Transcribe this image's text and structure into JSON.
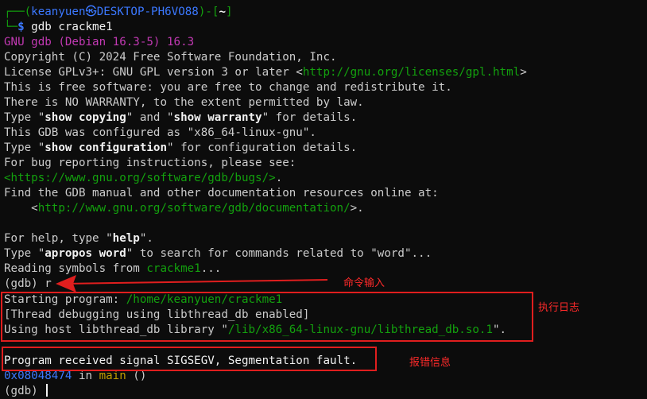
{
  "prompt": {
    "open": "┌──(",
    "user": "keanyuen",
    "at": "㉿",
    "host": "DESKTOP-PH6VO88",
    "mid": ")-[",
    "path": "~",
    "close": "]",
    "corner": "└─",
    "dollar": "$",
    "command": " gdb crackme1"
  },
  "gdb_banner": "GNU gdb (Debian 16.3-5) 16.3",
  "lines": {
    "copyright": "Copyright (C) 2024 Free Software Foundation, Inc.",
    "license_pre": "License GPLv3+: GNU GPL version 3 or later <",
    "license_url": "http://gnu.org/licenses/gpl.html",
    "license_post": ">",
    "free": "This is free software: you are free to change and redistribute it.",
    "warranty": "There is NO WARRANTY, to the extent permitted by law.",
    "type_pre": "Type \"",
    "show_copying": "show copying",
    "and": "\" and \"",
    "show_warranty": "show warranty",
    "for_details": "\" for details.",
    "configured": "This GDB was configured as \"x86_64-linux-gnu\".",
    "show_configuration": "show configuration",
    "for_config": "\" for configuration details.",
    "bug_reporting": "For bug reporting instructions, please see:",
    "bugs_url_open": "<",
    "bugs_url": "https://www.gnu.org/software/gdb/bugs/",
    "bugs_url_close": ">",
    "bugs_dot": ".",
    "find_manual": "Find the GDB manual and other documentation resources online at:",
    "doc_indent": "    <",
    "doc_url": "http://www.gnu.org/software/gdb/documentation/",
    "doc_close": ">.",
    "help_pre": "For help, type \"",
    "help": "help",
    "help_post": "\".",
    "apropos": "apropos word",
    "apropos_post": "\" to search for commands related to \"word\"...",
    "reading": "Reading symbols from ",
    "reading_file": "crackme1",
    "reading_post": "...",
    "gdb_r": "(gdb) r",
    "starting": "Starting program: ",
    "starting_path": "/home/keanyuen/crackme1",
    "thread_debug": "[Thread debugging using libthread_db enabled]",
    "using_host": "Using host libthread_db library \"",
    "libthread_path": "/lib/x86_64-linux-gnu/libthread_db.so.1",
    "using_host_post": "\".",
    "signal": "Program received signal SIGSEGV, Segmentation fault.",
    "addr": "0x08048474",
    "in": " in ",
    "func": "main",
    "parens": " ()",
    "gdb_prompt": "(gdb) "
  },
  "annotations": {
    "command_input": "命令输入",
    "exec_log": "执行日志",
    "error_info": "报错信息"
  },
  "colors": {
    "background": "#0c0c0c",
    "annotation": "#e01e1e"
  }
}
